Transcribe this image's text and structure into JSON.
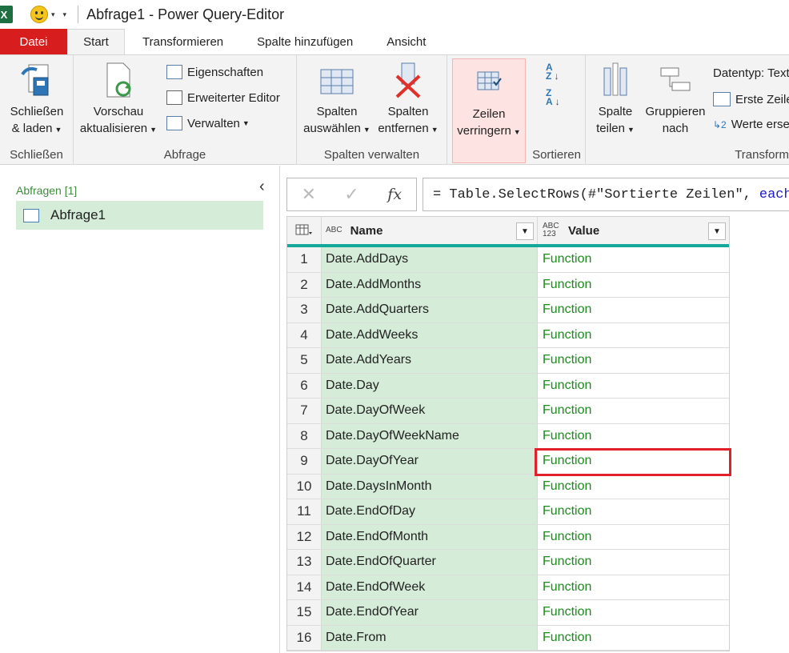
{
  "titlebar": {
    "app_icon": "X",
    "title": "Abfrage1 - Power Query-Editor"
  },
  "tabs": [
    "Datei",
    "Start",
    "Transformieren",
    "Spalte hinzufügen",
    "Ansicht"
  ],
  "ribbon": {
    "close_load": {
      "line1": "Schließen",
      "line2": "& laden",
      "group": "Schließen"
    },
    "refresh": {
      "line1": "Vorschau",
      "line2": "aktualisieren"
    },
    "properties": "Eigenschaften",
    "advanced_editor": "Erweiterter Editor",
    "manage": "Verwalten",
    "query_group": "Abfrage",
    "choose_columns": {
      "line1": "Spalten",
      "line2": "auswählen"
    },
    "remove_columns": {
      "line1": "Spalten",
      "line2": "entfernen"
    },
    "manage_columns_group": "Spalten verwalten",
    "reduce_rows": {
      "line1": "Zeilen",
      "line2": "verringern"
    },
    "sort_group": "Sortieren",
    "split_column": {
      "line1": "Spalte",
      "line2": "teilen"
    },
    "group_by": {
      "line1": "Gruppieren",
      "line2": "nach"
    },
    "datatype": "Datentyp: Text",
    "first_row": "Erste Zeile",
    "replace_values": "Werte erse",
    "transform_group": "Transform"
  },
  "queries": {
    "header": "Abfragen [1]",
    "items": [
      "Abfrage1"
    ]
  },
  "formula": {
    "text": "= Table.SelectRows(#\"Sortierte Zeilen\",",
    "keyword": "each"
  },
  "grid": {
    "columns": [
      {
        "type": "ABC",
        "name": "Name"
      },
      {
        "type": "ABC 123",
        "name": "Value"
      }
    ],
    "rows": [
      {
        "n": "1",
        "name": "Date.AddDays",
        "value": "Function"
      },
      {
        "n": "2",
        "name": "Date.AddMonths",
        "value": "Function"
      },
      {
        "n": "3",
        "name": "Date.AddQuarters",
        "value": "Function"
      },
      {
        "n": "4",
        "name": "Date.AddWeeks",
        "value": "Function"
      },
      {
        "n": "5",
        "name": "Date.AddYears",
        "value": "Function"
      },
      {
        "n": "6",
        "name": "Date.Day",
        "value": "Function"
      },
      {
        "n": "7",
        "name": "Date.DayOfWeek",
        "value": "Function"
      },
      {
        "n": "8",
        "name": "Date.DayOfWeekName",
        "value": "Function"
      },
      {
        "n": "9",
        "name": "Date.DayOfYear",
        "value": "Function"
      },
      {
        "n": "10",
        "name": "Date.DaysInMonth",
        "value": "Function"
      },
      {
        "n": "11",
        "name": "Date.EndOfDay",
        "value": "Function"
      },
      {
        "n": "12",
        "name": "Date.EndOfMonth",
        "value": "Function"
      },
      {
        "n": "13",
        "name": "Date.EndOfQuarter",
        "value": "Function"
      },
      {
        "n": "14",
        "name": "Date.EndOfWeek",
        "value": "Function"
      },
      {
        "n": "15",
        "name": "Date.EndOfYear",
        "value": "Function"
      },
      {
        "n": "16",
        "name": "Date.From",
        "value": "Function"
      }
    ]
  },
  "colors": {
    "file_tab": "#d71d1d",
    "name_column": "#d5ecd8",
    "function_text": "#1b8b1b",
    "highlight": "#e0202a"
  }
}
